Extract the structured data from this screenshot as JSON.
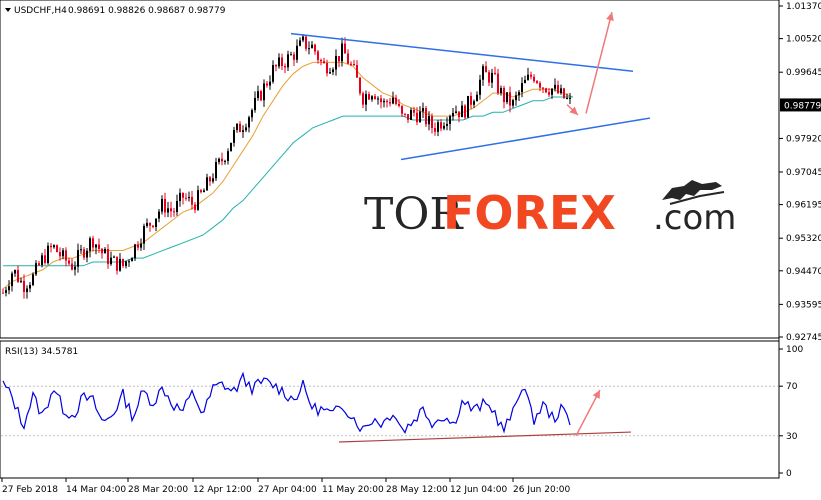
{
  "header": {
    "symbol": "USDCHF,H4",
    "ohlc": "0.98691 0.98826 0.98687 0.98779"
  },
  "rsi_header": {
    "label": "RSI(13) 34.5781"
  },
  "watermark": {
    "part1": "TOR",
    "part2": "FOREX",
    "part3": ".com"
  },
  "colors": {
    "bull_candle": "#000000",
    "bear_candle": "#e8001c",
    "ma_fast": "#e8a033",
    "ma_slow": "#20b2aa",
    "trendline": "#2f6fe8",
    "arrow": "#f07878",
    "rsi_line": "#0000e0",
    "rsi_support": "#b04040",
    "current_price_box": "#000000"
  },
  "chart_data": [
    {
      "type": "candlestick",
      "title": "USDCHF,H4",
      "price_axis_ticks": [
        "1.01370",
        "1.00520",
        "0.99645",
        "0.98779",
        "0.97920",
        "0.97045",
        "0.96195",
        "0.95320",
        "0.94470",
        "0.93595",
        "0.92745"
      ],
      "current_price": "0.98779",
      "ylim": [
        0.92745,
        1.0137
      ],
      "x_tick_labels": [
        "27 Feb 2018",
        "14 Mar 04:00",
        "28 Mar 20:00",
        "12 Apr 12:00",
        "27 Apr 04:00",
        "11 May 20:00",
        "28 May 12:00",
        "12 Jun 04:00",
        "26 Jun 20:00"
      ],
      "close_path": {
        "x": [
          0,
          10,
          20,
          30,
          40,
          50,
          60,
          70,
          80,
          90,
          100,
          110,
          120,
          130,
          140,
          150,
          160,
          170,
          180,
          190,
          200,
          210,
          220,
          230,
          240,
          250,
          260,
          270,
          280,
          290,
          300,
          310,
          320,
          330,
          340,
          350,
          360,
          370,
          380,
          390,
          400,
          410,
          420,
          430,
          440,
          450,
          460,
          470,
          480,
          490,
          500,
          510,
          520,
          530,
          540,
          550,
          560,
          570
        ],
        "values": [
          0.939,
          0.945,
          0.941,
          0.943,
          0.948,
          0.951,
          0.948,
          0.946,
          0.95,
          0.953,
          0.949,
          0.947,
          0.946,
          0.95,
          0.955,
          0.958,
          0.962,
          0.96,
          0.964,
          0.962,
          0.965,
          0.97,
          0.974,
          0.98,
          0.983,
          0.987,
          0.992,
          0.997,
          0.999,
          1.001,
          1.004,
          1.003,
          0.998,
          0.999,
          1.002,
          0.997,
          0.99,
          0.992,
          0.988,
          0.99,
          0.984,
          0.986,
          0.985,
          0.982,
          0.984,
          0.987,
          0.986,
          0.99,
          0.996,
          0.995,
          0.99,
          0.988,
          0.993,
          0.996,
          0.993,
          0.992,
          0.99,
          0.9878
        ]
      },
      "series": [
        {
          "name": "",
          "kind": "moving_average_fast",
          "values": [
            0.94,
            0.942,
            0.943,
            0.944,
            0.945,
            0.947,
            0.948,
            0.948,
            0.949,
            0.95,
            0.95,
            0.95,
            0.95,
            0.951,
            0.952,
            0.954,
            0.956,
            0.958,
            0.96,
            0.961,
            0.963,
            0.965,
            0.968,
            0.972,
            0.976,
            0.98,
            0.985,
            0.989,
            0.993,
            0.996,
            0.998,
            0.999,
            0.999,
            0.999,
            0.999,
            0.998,
            0.995,
            0.993,
            0.991,
            0.99,
            0.988,
            0.987,
            0.986,
            0.985,
            0.985,
            0.985,
            0.986,
            0.987,
            0.989,
            0.991,
            0.991,
            0.99,
            0.991,
            0.992,
            0.992,
            0.992,
            0.991,
            0.99
          ]
        },
        {
          "name": "",
          "kind": "moving_average_slow",
          "values": [
            0.946,
            0.946,
            0.946,
            0.946,
            0.946,
            0.946,
            0.946,
            0.946,
            0.946,
            0.947,
            0.947,
            0.947,
            0.947,
            0.948,
            0.948,
            0.949,
            0.95,
            0.951,
            0.952,
            0.953,
            0.954,
            0.956,
            0.958,
            0.961,
            0.963,
            0.966,
            0.969,
            0.972,
            0.975,
            0.978,
            0.98,
            0.982,
            0.983,
            0.984,
            0.985,
            0.985,
            0.985,
            0.985,
            0.985,
            0.985,
            0.985,
            0.984,
            0.984,
            0.984,
            0.984,
            0.984,
            0.984,
            0.985,
            0.985,
            0.986,
            0.986,
            0.987,
            0.988,
            0.989,
            0.989,
            0.99,
            0.99,
            0.99
          ]
        }
      ],
      "annotations": [
        {
          "kind": "trendline_upper",
          "from": [
            291,
            1.0065
          ],
          "to": [
            633,
            0.9967
          ]
        },
        {
          "kind": "trendline_lower",
          "from": [
            401,
            0.9737
          ],
          "to": [
            650,
            0.9845
          ]
        },
        {
          "kind": "arrow",
          "from": [
            567,
            0.988
          ],
          "to": [
            578,
            0.9853
          ]
        },
        {
          "kind": "arrow",
          "from": [
            586,
            0.9857
          ],
          "to": [
            612,
            1.0121
          ]
        }
      ]
    },
    {
      "type": "line",
      "title": "RSI(13) 34.5781",
      "ylim": [
        0,
        100
      ],
      "y_ticks": [
        "100",
        "70",
        "30",
        "0"
      ],
      "levels": [
        70,
        30
      ],
      "x": [
        0,
        10,
        20,
        30,
        40,
        50,
        60,
        70,
        80,
        90,
        100,
        110,
        120,
        130,
        140,
        150,
        160,
        170,
        180,
        190,
        200,
        210,
        220,
        230,
        240,
        250,
        260,
        270,
        280,
        290,
        300,
        310,
        320,
        330,
        340,
        350,
        360,
        370,
        380,
        390,
        400,
        410,
        420,
        430,
        440,
        450,
        460,
        470,
        480,
        490,
        500,
        510,
        520,
        530,
        540,
        550,
        560,
        570
      ],
      "values": [
        72,
        60,
        38,
        62,
        45,
        70,
        52,
        46,
        61,
        58,
        40,
        48,
        63,
        45,
        66,
        57,
        69,
        55,
        50,
        65,
        47,
        68,
        72,
        65,
        76,
        68,
        74,
        71,
        66,
        59,
        70,
        52,
        51,
        47,
        55,
        45,
        35,
        44,
        40,
        50,
        34,
        42,
        52,
        40,
        47,
        39,
        59,
        50,
        55,
        52,
        34,
        48,
        74,
        42,
        55,
        44,
        52,
        34.58
      ],
      "annotations": [
        {
          "kind": "support_line",
          "from": [
            339,
            25
          ],
          "to": [
            631,
            33
          ]
        },
        {
          "kind": "arrow",
          "from": [
            576,
            30
          ],
          "to": [
            600,
            67
          ]
        }
      ]
    }
  ]
}
